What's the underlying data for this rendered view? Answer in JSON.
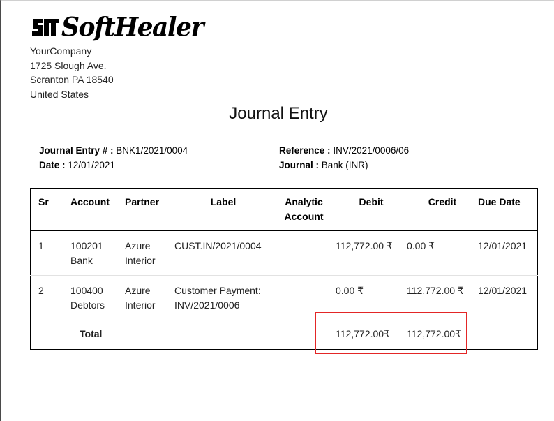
{
  "company": {
    "logo_text": "SoftHealer",
    "name": "YourCompany",
    "address_lines": [
      "1725 Slough Ave.",
      "Scranton PA 18540",
      "United States"
    ]
  },
  "document": {
    "title": "Journal Entry",
    "journal_entry_label": "Journal Entry # :",
    "journal_entry_value": "BNK1/2021/0004",
    "date_label": "Date :",
    "date_value": "12/01/2021",
    "reference_label": "Reference :",
    "reference_value": "INV/2021/0006/06",
    "journal_label": "Journal :",
    "journal_value": "Bank (INR)"
  },
  "table": {
    "headers": {
      "sr": "Sr",
      "account": "Account",
      "partner": "Partner",
      "label": "Label",
      "analytic_line1": "Analytic",
      "analytic_line2": "Account",
      "debit": "Debit",
      "credit": "Credit",
      "due_date": "Due Date"
    },
    "rows": [
      {
        "sr": "1",
        "account_code": "100201",
        "account_name": "Bank",
        "partner_line1": "Azure",
        "partner_line2": "Interior",
        "label_line1": "CUST.IN/2021/0004",
        "label_line2": "",
        "analytic": "",
        "debit": "112,772.00 ₹",
        "credit": "0.00 ₹",
        "due_date": "12/01/2021"
      },
      {
        "sr": "2",
        "account_code": "100400",
        "account_name": "Debtors",
        "partner_line1": "Azure",
        "partner_line2": "Interior",
        "label_line1": "Customer Payment:",
        "label_line2": "INV/2021/0006",
        "analytic": "",
        "debit": "0.00 ₹",
        "credit": "112,772.00 ₹",
        "due_date": "12/01/2021"
      }
    ],
    "total": {
      "label": "Total",
      "debit": "112,772.00₹",
      "credit": "112,772.00₹"
    }
  },
  "colors": {
    "highlight_border": "#e32626"
  }
}
